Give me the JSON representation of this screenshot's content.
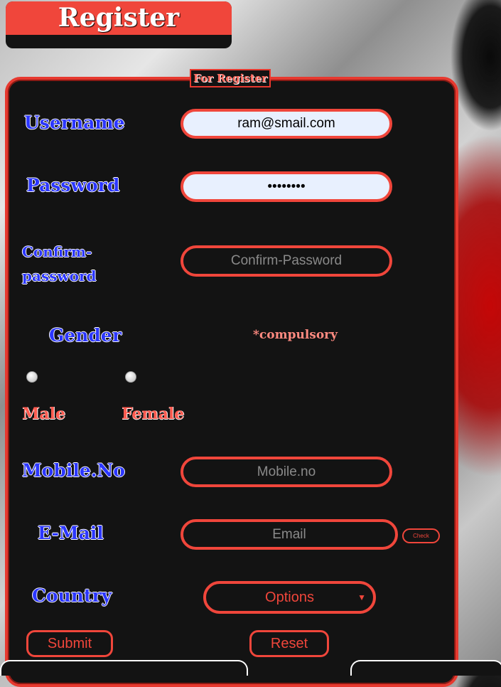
{
  "header": {
    "title": "Register"
  },
  "form": {
    "legend": "For Register",
    "username": {
      "label": "Username",
      "value": "ram@smail.com"
    },
    "password": {
      "label": "Password",
      "value": "••••••••"
    },
    "confirm": {
      "label": "Confirm-password",
      "placeholder": "Confirm-Password"
    },
    "gender": {
      "label": "Gender",
      "required_note": "*compulsory",
      "options": [
        "Male",
        "Female"
      ]
    },
    "mobile": {
      "label": "Mobile.No",
      "placeholder": "Mobile.no"
    },
    "email": {
      "label": "E-Mail",
      "placeholder": "Email",
      "check_label": "Check"
    },
    "country": {
      "label": "Country",
      "selected": "Options"
    },
    "submit_label": "Submit",
    "reset_label": "Reset"
  },
  "colors": {
    "accent": "#f0463b",
    "label_blue": "#2b36ff",
    "panel": "#131313"
  }
}
